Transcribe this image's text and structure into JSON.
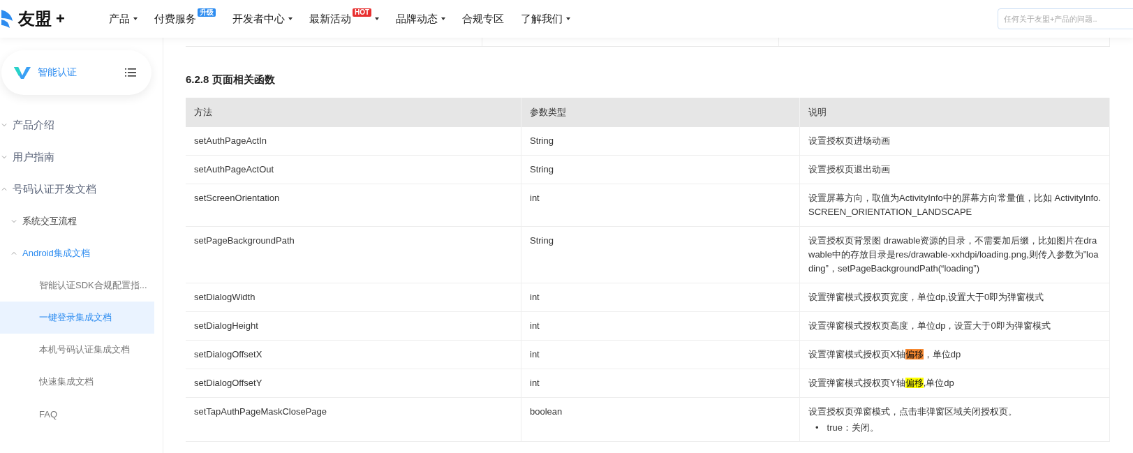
{
  "header": {
    "logo_text": "友盟",
    "logo_plus": "+",
    "nav": [
      {
        "label": "产品",
        "caret": true
      },
      {
        "label": "付费服务",
        "caret": false,
        "badge": {
          "text": "升级",
          "kind": "new"
        }
      },
      {
        "label": "开发者中心",
        "caret": true
      },
      {
        "label": "最新活动",
        "caret": true,
        "badge": {
          "text": "HOT",
          "kind": "hot"
        }
      },
      {
        "label": "品牌动态",
        "caret": true
      },
      {
        "label": "合规专区",
        "caret": false
      },
      {
        "label": "了解我们",
        "caret": true
      }
    ],
    "search": {
      "placeholder": "任何关于友盟+产品的问题.."
    }
  },
  "sidebar": {
    "product": "智能认证",
    "tree": [
      {
        "label": "产品介绍",
        "expanded": false,
        "selected": false
      },
      {
        "label": "用户指南",
        "expanded": false,
        "selected": false
      },
      {
        "label": "号码认证开发文档",
        "expanded": true,
        "selected": false,
        "children": [
          {
            "label": "系统交互流程",
            "expanded": false,
            "selected": false
          },
          {
            "label": "Android集成文档",
            "expanded": true,
            "selected": false,
            "children": [
              {
                "label": "智能认证SDK合规配置指...",
                "selected": false
              },
              {
                "label": "一键登录集成文档",
                "selected": true
              },
              {
                "label": "本机号码认证集成文档",
                "selected": false
              },
              {
                "label": "快速集成文档",
                "selected": false
              },
              {
                "label": "FAQ",
                "selected": false
              }
            ]
          }
        ]
      }
    ]
  },
  "content": {
    "heading": "6.2.8 页面相关函数",
    "table": {
      "columns": [
        "方法",
        "参数类型",
        "说明"
      ],
      "rows": [
        {
          "method": "setAuthPageActIn",
          "type": "String",
          "desc": [
            {
              "text": "设置授权页进场动画"
            }
          ]
        },
        {
          "method": "setAuthPageActOut",
          "type": "String",
          "desc": [
            {
              "text": "设置授权页退出动画"
            }
          ]
        },
        {
          "method": "setScreenOrientation",
          "type": "int",
          "desc": [
            {
              "text": "设置屏幕方向，取值为ActivityInfo中的屏幕方向常量值，比如 ActivityInfo.SCREEN_ORIENTATION_LANDSCAPE"
            }
          ]
        },
        {
          "method": "setPageBackgroundPath",
          "type": "String",
          "desc": [
            {
              "text": "设置授权页背景图 drawable资源的目录，不需要加后缀，比如图片在drawable中的存放目录是res/drawable-xxhdpi/loading.png,则传入参数为”loading”，setPageBackgroundPath(“loading”)"
            }
          ]
        },
        {
          "method": "setDialogWidth",
          "type": "int",
          "desc": [
            {
              "text": "设置弹窗模式授权页宽度，单位dp,设置大于0即为弹窗模式"
            }
          ]
        },
        {
          "method": "setDialogHeight",
          "type": "int",
          "desc": [
            {
              "text": "设置弹窗模式授权页高度，单位dp，设置大于0即为弹窗模式"
            }
          ]
        },
        {
          "method": "setDialogOffsetX",
          "type": "int",
          "desc": [
            {
              "text": "设置弹窗模式授权页X轴"
            },
            {
              "text": "偏移",
              "kind": "current_match"
            },
            {
              "text": "，单位dp"
            }
          ]
        },
        {
          "method": "setDialogOffsetY",
          "type": "int",
          "desc": [
            {
              "text": "设置弹窗模式授权页Y轴"
            },
            {
              "text": "偏移",
              "kind": "match"
            },
            {
              "text": ",单位dp"
            }
          ]
        },
        {
          "method": "setTapAuthPageMaskClosePage",
          "type": "boolean",
          "desc": [
            {
              "text": "设置授权页弹窗模式，点击非弹窗区域关闭授权页。"
            }
          ],
          "bullets": [
            {
              "marker": "•",
              "text": "true：关闭。"
            }
          ]
        }
      ]
    }
  }
}
